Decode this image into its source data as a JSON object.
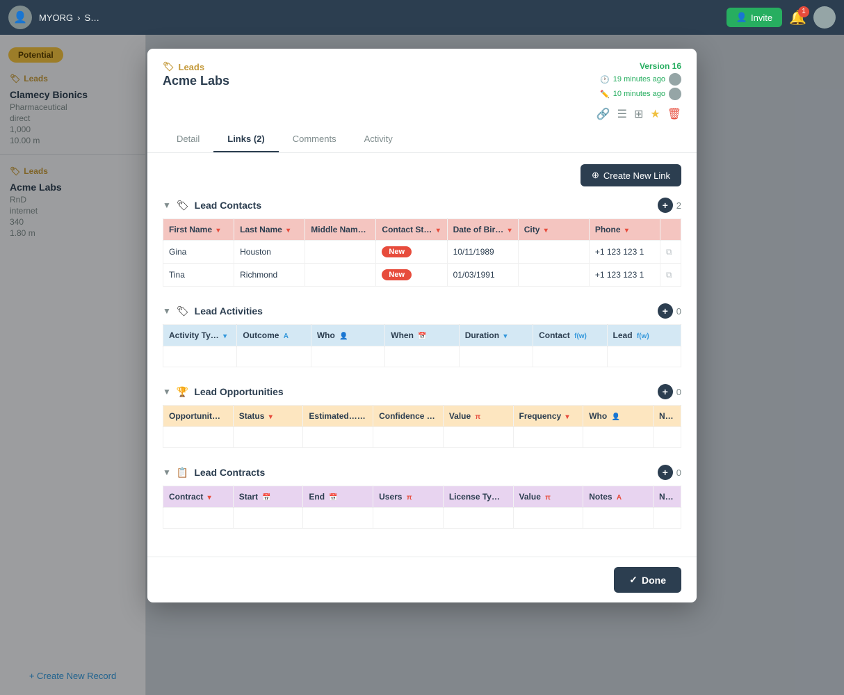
{
  "topbar": {
    "org_name": "MYORG",
    "invite_label": "Invite",
    "notification_count": "1"
  },
  "sidebar": {
    "potential_badge": "Potential",
    "section1": {
      "title": "Leads",
      "item_name": "Clamecy Bionics",
      "detail1": "Pharmaceutical",
      "detail2": "direct",
      "detail3": "1,000",
      "detail4": "10.00 m"
    },
    "section2": {
      "title": "Leads",
      "item_name": "Acme Labs",
      "detail1": "RnD",
      "detail2": "internet",
      "detail3": "340",
      "detail4": "1.80 m"
    },
    "create_new_record": "+ Create New Record"
  },
  "modal": {
    "leads_label": "Leads",
    "entity_name": "Acme Labs",
    "version_label": "Version 16",
    "time1": "19 minutes ago",
    "time2": "10 minutes ago",
    "tabs": [
      {
        "label": "Detail",
        "active": false
      },
      {
        "label": "Links (2)",
        "active": true
      },
      {
        "label": "Comments",
        "active": false
      },
      {
        "label": "Activity",
        "active": false
      }
    ],
    "create_link_btn": "Create New Link",
    "sections": {
      "contacts": {
        "title": "Lead Contacts",
        "count": "2",
        "columns": [
          "First Name",
          "Last Name",
          "Middle Nam…",
          "Contact St…",
          "Date of Bir…",
          "City",
          "Phone",
          ""
        ],
        "rows": [
          {
            "first": "Gina",
            "last": "Houston",
            "middle": "",
            "status": "New",
            "dob": "10/11/1989",
            "city": "",
            "phone": "+1 123 123 1",
            "action": ""
          },
          {
            "first": "Tina",
            "last": "Richmond",
            "middle": "",
            "status": "New",
            "dob": "01/03/1991",
            "city": "",
            "phone": "+1 123 123 1",
            "action": ""
          }
        ]
      },
      "activities": {
        "title": "Lead Activities",
        "count": "0",
        "columns": [
          "Activity Ty…",
          "Outcome",
          "Who",
          "When",
          "Duration",
          "Contact",
          "Lead"
        ]
      },
      "opportunities": {
        "title": "Lead Opportunities",
        "count": "0",
        "columns": [
          "Opportunit…",
          "Status",
          "Estimated…",
          "Confidence %",
          "Value",
          "Frequency",
          "Who",
          "N…"
        ]
      },
      "contracts": {
        "title": "Lead Contracts",
        "count": "0",
        "columns": [
          "Contract",
          "Start",
          "End",
          "Users",
          "License Ty…",
          "Value",
          "Notes",
          "N…"
        ]
      }
    },
    "done_label": "Done"
  }
}
